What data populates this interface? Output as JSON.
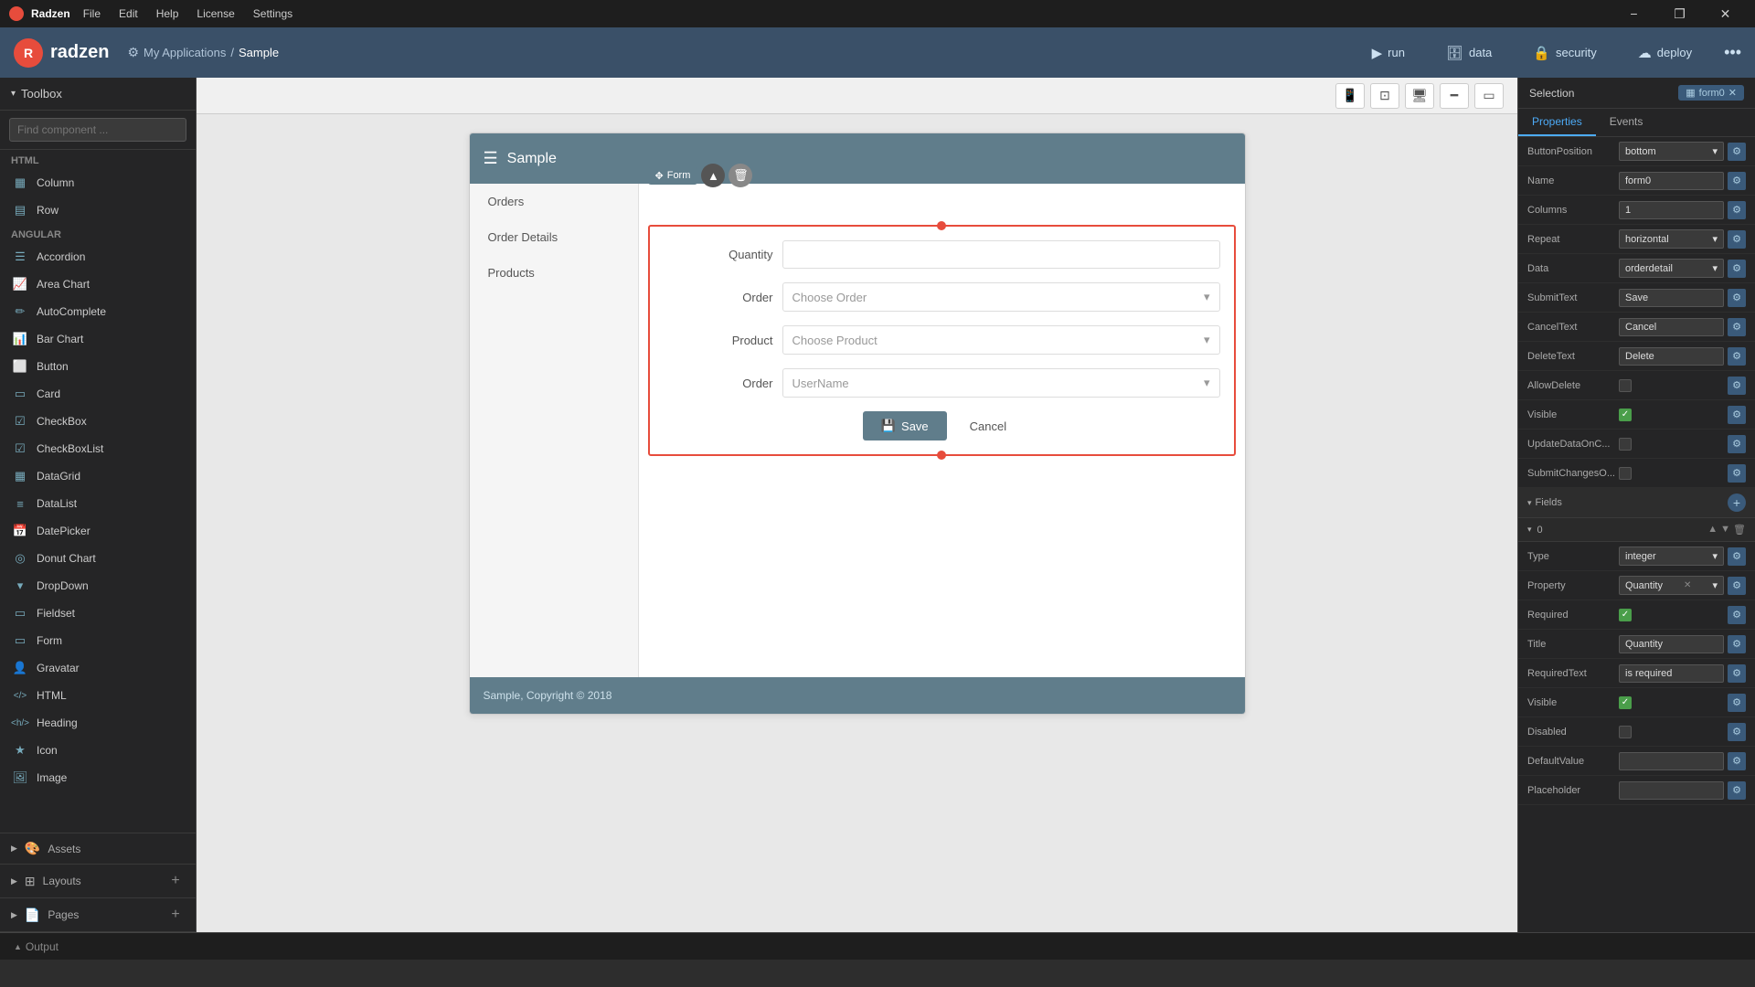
{
  "titlebar": {
    "app_name": "Radzen",
    "menu_items": [
      "File",
      "Edit",
      "Help",
      "License",
      "Settings"
    ],
    "win_minimize": "−",
    "win_maximize": "❐",
    "win_close": "✕"
  },
  "toolbar": {
    "logo_text": "radzen",
    "breadcrumb_app": "My Applications",
    "breadcrumb_sep": "/",
    "breadcrumb_page": "Sample",
    "run_label": "run",
    "data_label": "data",
    "security_label": "security",
    "deploy_label": "deploy",
    "more_icon": "•••"
  },
  "toolbox": {
    "header": "Toolbox",
    "search_placeholder": "Find component ...",
    "sections": {
      "html_label": "HTML",
      "angular_label": "Angular"
    },
    "html_items": [
      {
        "label": "Column",
        "icon": "▦"
      },
      {
        "label": "Row",
        "icon": "▤"
      }
    ],
    "angular_items": [
      {
        "label": "Accordion",
        "icon": "☰"
      },
      {
        "label": "Area Chart",
        "icon": "📈"
      },
      {
        "label": "AutoComplete",
        "icon": "✏"
      },
      {
        "label": "Bar Chart",
        "icon": "📊"
      },
      {
        "label": "Button",
        "icon": "⬜"
      },
      {
        "label": "Card",
        "icon": "▭"
      },
      {
        "label": "CheckBox",
        "icon": "☑"
      },
      {
        "label": "CheckBoxList",
        "icon": "☑"
      },
      {
        "label": "DataGrid",
        "icon": "▦"
      },
      {
        "label": "DataList",
        "icon": "≡"
      },
      {
        "label": "DatePicker",
        "icon": "📅"
      },
      {
        "label": "Donut Chart",
        "icon": "◎"
      },
      {
        "label": "DropDown",
        "icon": "▾"
      },
      {
        "label": "Fieldset",
        "icon": "▭"
      },
      {
        "label": "Form",
        "icon": "▭"
      },
      {
        "label": "Gravatar",
        "icon": "👤"
      },
      {
        "label": "HTML",
        "icon": "</>"
      },
      {
        "label": "Heading",
        "icon": "<h/>"
      },
      {
        "label": "Icon",
        "icon": "★"
      },
      {
        "label": "Image",
        "icon": "🖼"
      }
    ],
    "bottom_sections": [
      {
        "label": "Assets",
        "arrow": "▶"
      },
      {
        "label": "Layouts",
        "arrow": "▶"
      },
      {
        "label": "Pages",
        "arrow": "▶"
      }
    ]
  },
  "device_toolbar": {
    "buttons": [
      "📱",
      "⊡",
      "🖥",
      "━",
      "▭"
    ]
  },
  "app_frame": {
    "header_title": "Sample",
    "nav_items": [
      "Orders",
      "Order Details",
      "Products"
    ],
    "form_label": "Form",
    "form_fields": [
      {
        "label": "Quantity",
        "type": "input",
        "value": ""
      },
      {
        "label": "Order",
        "type": "select",
        "placeholder": "Choose Order"
      },
      {
        "label": "Product",
        "type": "select",
        "placeholder": "Choose Product"
      },
      {
        "label": "Order",
        "type": "select",
        "placeholder": "UserName"
      }
    ],
    "save_btn": "Save",
    "cancel_btn": "Cancel",
    "footer_text": "Sample, Copyright © 2018"
  },
  "right_panel": {
    "selection_label": "Selection",
    "form_name": "form0",
    "close_icon": "✕",
    "tabs": [
      "Properties",
      "Events"
    ],
    "active_tab": "Properties",
    "properties": [
      {
        "key": "ButtonPosition",
        "type": "select",
        "value": "bottom"
      },
      {
        "key": "Name",
        "type": "input",
        "value": "form0"
      },
      {
        "key": "Columns",
        "type": "input",
        "value": "1"
      },
      {
        "key": "Repeat",
        "type": "select",
        "value": "horizontal"
      },
      {
        "key": "Data",
        "type": "select",
        "value": "orderdetail"
      },
      {
        "key": "SubmitText",
        "type": "input",
        "value": "Save"
      },
      {
        "key": "CancelText",
        "type": "input",
        "value": "Cancel"
      },
      {
        "key": "DeleteText",
        "type": "input",
        "value": "Delete"
      },
      {
        "key": "AllowDelete",
        "type": "checkbox",
        "value": false
      },
      {
        "key": "Visible",
        "type": "checkbox",
        "value": true
      },
      {
        "key": "UpdateDataOnC...",
        "type": "checkbox",
        "value": false
      },
      {
        "key": "SubmitChangesO...",
        "type": "checkbox",
        "value": false
      }
    ],
    "fields_section": {
      "label": "Fields",
      "items": [
        {
          "number": "0"
        }
      ]
    },
    "field_properties": [
      {
        "key": "Type",
        "type": "select",
        "value": "integer"
      },
      {
        "key": "Property",
        "type": "select-tag",
        "value": "Quantity"
      },
      {
        "key": "Required",
        "type": "checkbox",
        "value": true
      },
      {
        "key": "Title",
        "type": "input",
        "value": "Quantity"
      },
      {
        "key": "RequiredText",
        "type": "input",
        "value": "is required"
      },
      {
        "key": "Visible",
        "type": "checkbox",
        "value": true
      },
      {
        "key": "Disabled",
        "type": "checkbox",
        "value": false
      },
      {
        "key": "DefaultValue",
        "type": "input",
        "value": ""
      },
      {
        "key": "Placeholder",
        "type": "input",
        "value": ""
      }
    ]
  },
  "output_bar": {
    "label": "Output"
  }
}
